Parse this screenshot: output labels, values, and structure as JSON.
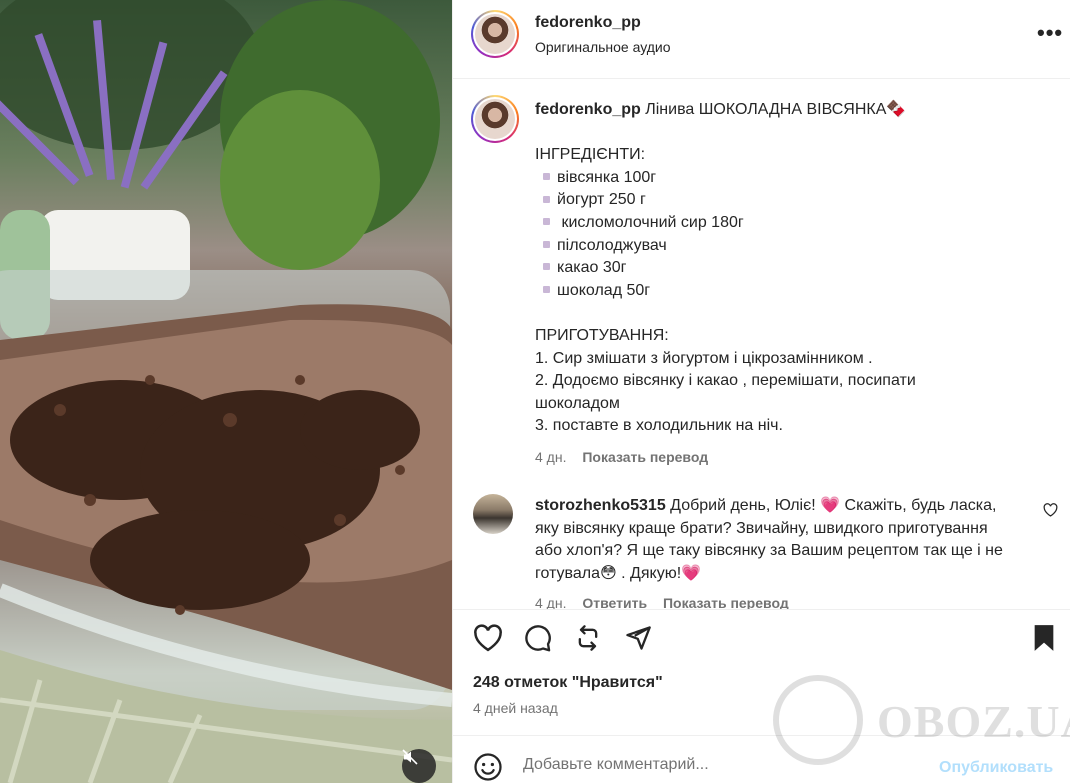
{
  "post": {
    "username": "fedorenko_pp",
    "audio": "Оригинальное аудио",
    "more": "•••"
  },
  "caption": {
    "username": "fedorenko_pp",
    "title": "Лінива ШОКОЛАДНА ВІВСЯНКА🍫",
    "ingredients_header": "ІНГРЕДІЄНТИ:",
    "ingredients": [
      "вівсянка 100г",
      "йогурт 250 г",
      " кисломолочний сир 180г",
      "пілсолоджувач",
      "какао 30г",
      "шоколад 50г"
    ],
    "steps_header": "ПРИГОТУВАННЯ:",
    "steps": [
      "1. Сир змішати з йогуртом і цікрозамінником .",
      "2. Додоємо вівсянку і какао , перемішати, посипати шоколадом",
      "3. поставте в холодильник на ніч."
    ],
    "time": "4 дн.",
    "translate": "Показать перевод"
  },
  "comment": {
    "username": "storozhenko5315",
    "text": "Добрий день, Юліє! 💗  Скажіть, будь ласка, яку вівсянку краще брати? Звичайну, швидкого приготування або хлоп'я? Я ще таку вівсянку за Вашим рецептом так ще і не готувала😳 . Дякую!💗",
    "time": "4 дн.",
    "reply": "Ответить",
    "translate": "Показать перевод"
  },
  "stats": {
    "likes": "248 отметок \"Нравится\"",
    "date": "4 дней назад"
  },
  "composer": {
    "placeholder": "Добавьте комментарий...",
    "post_label": "Опубликовать"
  },
  "watermark": {
    "text": "OBOZ.UA"
  },
  "colors": {
    "accent_disabled": "#b2dffc",
    "secondary_text": "#737373",
    "heart": "#e0245e"
  }
}
